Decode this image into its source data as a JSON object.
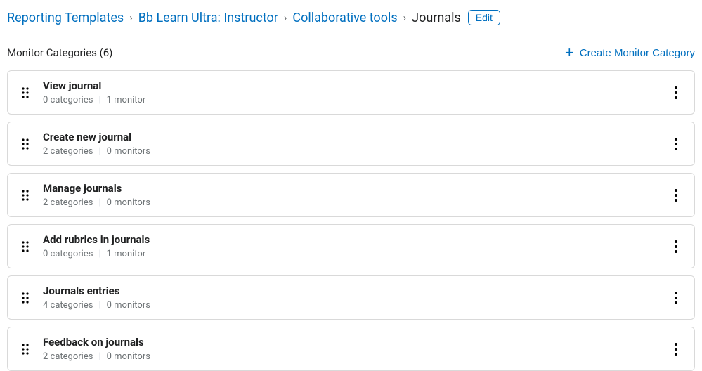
{
  "breadcrumb": {
    "items": [
      {
        "label": "Reporting Templates",
        "link": true
      },
      {
        "label": "Bb Learn Ultra: Instructor",
        "link": true
      },
      {
        "label": "Collaborative tools",
        "link": true
      },
      {
        "label": "Journals",
        "link": false
      }
    ],
    "edit_label": "Edit"
  },
  "list": {
    "title": "Monitor Categories (6)",
    "create_label": "Create Monitor Category",
    "items": [
      {
        "title": "View journal",
        "categories": "0 categories",
        "monitors": "1 monitor"
      },
      {
        "title": "Create new journal",
        "categories": "2 categories",
        "monitors": "0 monitors"
      },
      {
        "title": "Manage journals",
        "categories": "2 categories",
        "monitors": "0 monitors"
      },
      {
        "title": "Add rubrics in journals",
        "categories": "0 categories",
        "monitors": "1 monitor"
      },
      {
        "title": "Journals entries",
        "categories": "4 categories",
        "monitors": "0 monitors"
      },
      {
        "title": "Feedback on journals",
        "categories": "2 categories",
        "monitors": "0 monitors"
      }
    ]
  }
}
